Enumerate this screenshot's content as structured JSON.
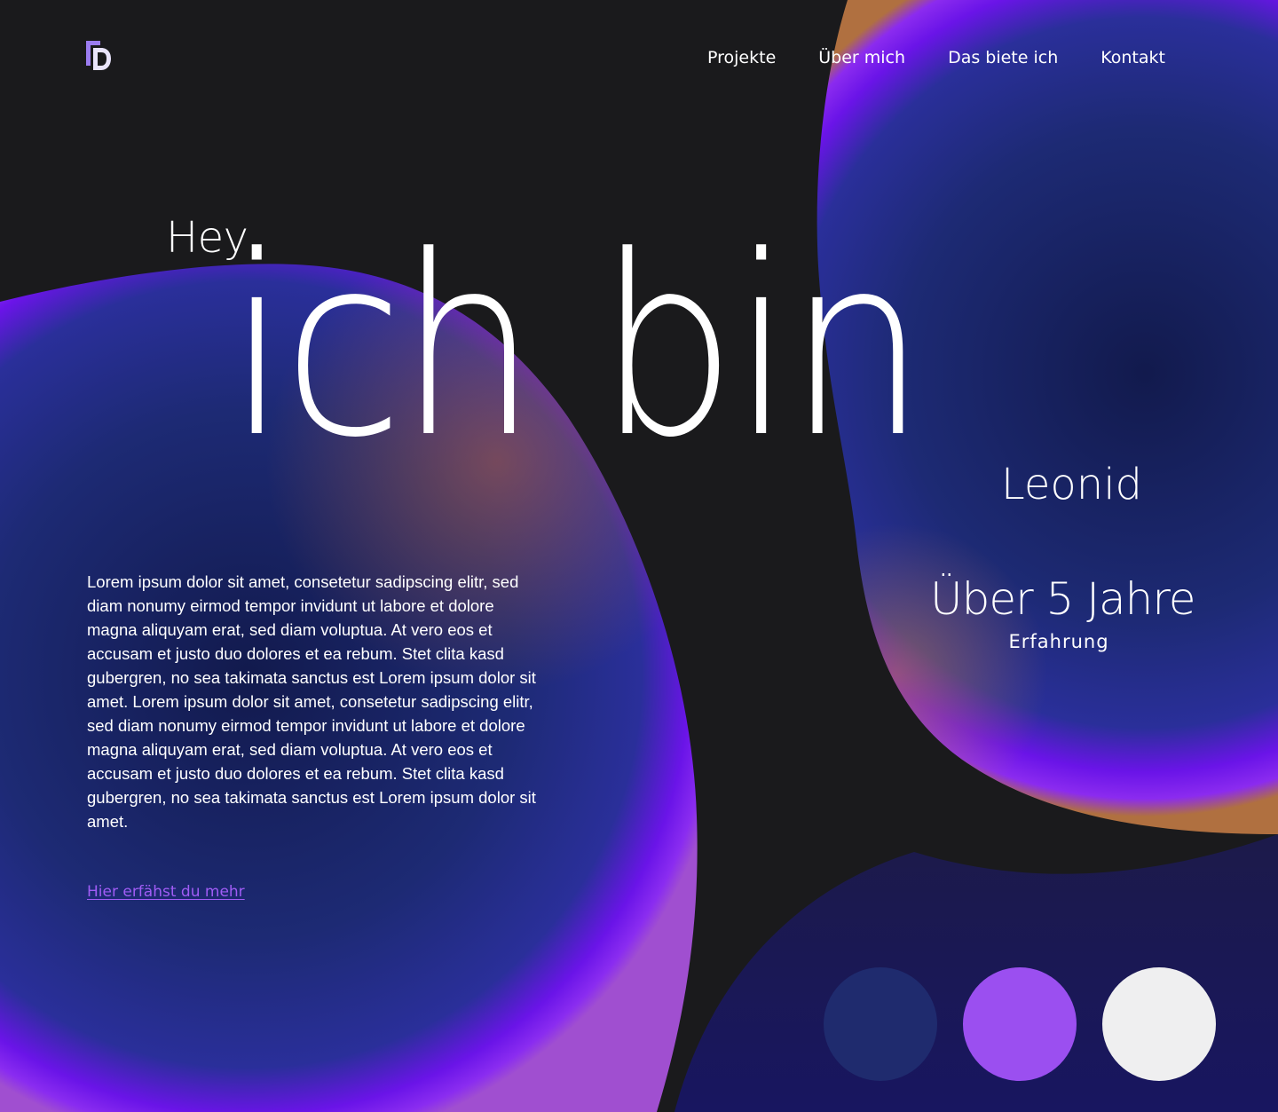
{
  "header": {
    "logo_icon": "monogram-d-logo",
    "nav": [
      {
        "label": "Projekte"
      },
      {
        "label": "Über mich"
      },
      {
        "label": "Das biete ich"
      },
      {
        "label": "Kontakt"
      }
    ]
  },
  "hero": {
    "greeting": "Hey,",
    "headline": "ich bin",
    "name": "Leonid"
  },
  "experience": {
    "value": "Über 5 Jahre",
    "label": "Erfahrung"
  },
  "intro": {
    "text": "Lorem ipsum dolor sit amet, consetetur sadipscing elitr, sed diam nonumy eirmod tempor invidunt ut labore et dolore magna aliquyam erat, sed diam voluptua. At vero eos et accusam et justo duo dolores et ea rebum. Stet clita kasd gubergren, no sea takimata sanctus est Lorem ipsum dolor sit amet. Lorem ipsum dolor sit amet, consetetur sadipscing elitr, sed diam nonumy eirmod tempor invidunt ut labore et dolore magna aliquyam erat, sed diam voluptua. At vero eos et accusam et justo duo dolores et ea rebum. Stet clita kasd gubergren, no sea takimata sanctus est Lorem ipsum dolor sit amet.",
    "link_label": "Hier erfähst du mehr"
  },
  "colors": {
    "background": "#1a1a1c",
    "accent_purple": "#9d4ff2",
    "link": "#a05cf5",
    "deep_blue": "#1e2d7a",
    "violet_edge": "#7a10f0",
    "warm_edge": "#b0704a",
    "light": "#efeff0"
  },
  "palette": [
    {
      "color": "#1f2b6e"
    },
    {
      "color": "#9b4ff0"
    },
    {
      "color": "#efeff0"
    }
  ]
}
